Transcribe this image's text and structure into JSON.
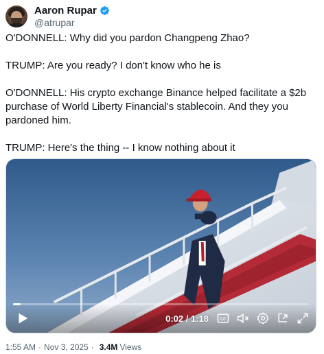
{
  "author": {
    "display_name": "Aaron Rupar",
    "handle": "@atrupar",
    "verified": true,
    "verified_color": "#1d9bf0",
    "avatar_icon": "profile-photo"
  },
  "tweet": {
    "paragraphs": [
      "O'DONNELL: Why did you pardon Changpeng Zhao?",
      "TRUMP: Are you ready? I don't know who he is",
      "O'DONNELL: His crypto exchange Binance helped facilitate a $2b purchase of World Liberty Financial's stablecoin. And they you pardoned him.",
      "TRUMP: Here's the thing -- I know nothing about it"
    ]
  },
  "video": {
    "time_display": "0:02 / 1:18",
    "progress_fraction": 0.026,
    "controls": [
      "play-icon",
      "captions-icon",
      "volume-icon",
      "settings-icon",
      "pop-out-icon",
      "fullscreen-icon"
    ]
  },
  "meta": {
    "time": "1:55 AM",
    "separator": "·",
    "date": "Nov 3, 2025",
    "views_count": "3.4M",
    "views_label": "Views"
  }
}
